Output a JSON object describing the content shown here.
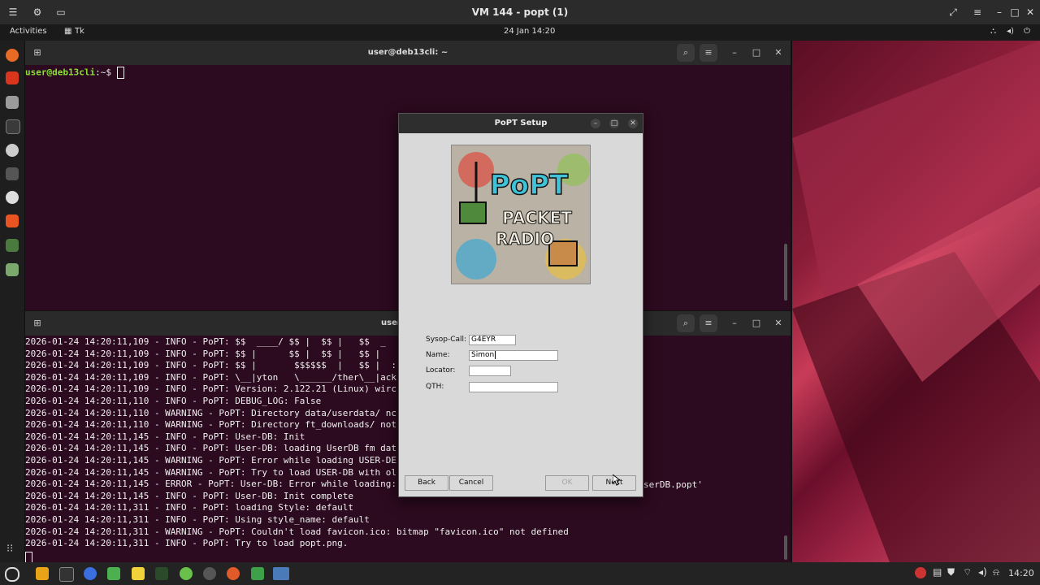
{
  "vm": {
    "title": "VM 144 - popt (1)"
  },
  "gnome": {
    "activities": "Activities",
    "app_name": "Tk",
    "clock": "24 Jan  14:20"
  },
  "term1": {
    "title": "user@deb13cli: ~",
    "prompt": "user@deb13cli",
    "prompt_suffix": ":~$ "
  },
  "term2": {
    "title": "user@c38-u",
    "lines": [
      "2026-01-24 14:20:11,109 - INFO - PoPT: $$  ____/ $$ |  $$ |   $$  _",
      "2026-01-24 14:20:11,109 - INFO - PoPT: $$ |      $$ |  $$ |   $$ |",
      "2026-01-24 14:20:11,109 - INFO - PoPT: $$ |       $$$$$$  |   $$ |  :",
      "2026-01-24 14:20:11,109 - INFO - PoPT: \\__|yton   \\______/ther\\__|ack",
      "2026-01-24 14:20:11,109 - INFO - PoPT: Version: 2.122.21 (Linux) wirc",
      "2026-01-24 14:20:11,110 - INFO - PoPT: DEBUG_LOG: False",
      "2026-01-24 14:20:11,110 - WARNING - PoPT: Directory data/userdata/ nc",
      "2026-01-24 14:20:11,110 - WARNING - PoPT: Directory ft_downloads/ not",
      "2026-01-24 14:20:11,145 - INFO - PoPT: User-DB: Init",
      "2026-01-24 14:20:11,145 - INFO - PoPT: User-DB: loading UserDB fm dat",
      "2026-01-24 14:20:11,145 - WARNING - PoPT: Error while loading USER-DE",
      "2026-01-24 14:20:11,145 - WARNING - PoPT: Try to load USER-DB with ol",
      "2026-01-24 14:20:11,145 - ERROR - PoPT: User-DB: Error while loading:",
      "2026-01-24 14:20:11,145 - INFO - PoPT: User-DB: Init complete",
      "2026-01-24 14:20:11,311 - INFO - PoPT: loading Style: default",
      "2026-01-24 14:20:11,311 - INFO - PoPT: Using style_name: default",
      "2026-01-24 14:20:11,311 - WARNING - PoPT: Couldn't load favicon.ico: bitmap \"favicon.ico\" not defined",
      "2026-01-24 14:20:11,311 - INFO - PoPT: Try to load popt.png."
    ],
    "overflow_text": "serDB.popt'"
  },
  "dialog": {
    "title": "PoPT Setup",
    "logo": {
      "line1": "PoPT",
      "line2": "PACKET",
      "line3": "RADIO"
    },
    "fields": {
      "sysop_call": {
        "label": "Sysop-Call:",
        "value": "G4EYR"
      },
      "name": {
        "label": "Name:",
        "value": "Simon"
      },
      "locator": {
        "label": "Locator:",
        "value": ""
      },
      "qth": {
        "label": "QTH:",
        "value": ""
      }
    },
    "buttons": {
      "back": "Back",
      "cancel": "Cancel",
      "ok": "OK",
      "next": "Next"
    }
  },
  "taskbar": {
    "clock": "14:20"
  },
  "colors": {
    "prompt_green": "#8ae234",
    "terminal_bg": "#2c0a1f"
  }
}
